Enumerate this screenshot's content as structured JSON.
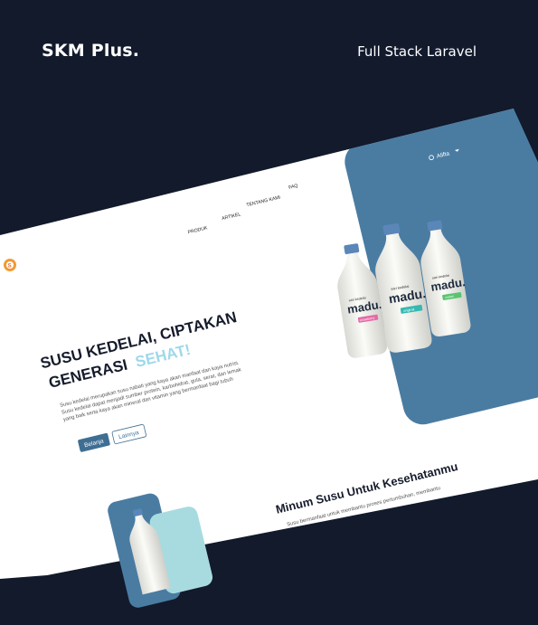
{
  "header": {
    "brand": "SKM Plus.",
    "tagline": "Full Stack Laravel"
  },
  "site": {
    "nav": [
      {
        "label": "PRODUK"
      },
      {
        "label": "ARTIKEL"
      },
      {
        "label": "TENTANG KAMI"
      },
      {
        "label": "FAQ"
      }
    ],
    "user": {
      "name": "Alifta",
      "icon": "user-icon"
    },
    "logo_icon": "brand-logo-icon",
    "hero": {
      "title_line1": "SUSU KEDELAI, CIPTAKAN",
      "title_line2": "GENERASI",
      "title_highlight": "SEHAT!",
      "desc_line1": "Susu kedelai merupakan susu nabati yang kaya akan manfaat dan kaya nutrisi.",
      "desc_line2": "Susu kedelai dapat menjadi sumber protein, karbohidrat, gula, serat, dan lemak",
      "desc_line3": "yang baik serta kaya akan mineral dan vitamin yang bermanfaat bagi tubuh",
      "primary_button": "Belanja",
      "secondary_button": "Lainnya"
    },
    "products": [
      {
        "brand": "madu.",
        "sub": "sari kedelai",
        "tag": "strawberry",
        "tag_color": "#e46aa6"
      },
      {
        "brand": "madu.",
        "sub": "sari kedelai",
        "tag": "original",
        "tag_color": "#35b9b0"
      },
      {
        "brand": "madu.",
        "sub": "sari kedelai",
        "tag": "melon",
        "tag_color": "#59c46f"
      }
    ],
    "section2": {
      "title": "Minum Susu Untuk Kesehatanmu",
      "desc": "Susu bermanfaat untuk membantu proses pertumbuhan, membantu"
    }
  },
  "colors": {
    "background": "#121a2c",
    "panel_blue": "#4a7ca2",
    "accent_blue": "#3f6e93",
    "highlight_text": "#9fd8ea"
  }
}
